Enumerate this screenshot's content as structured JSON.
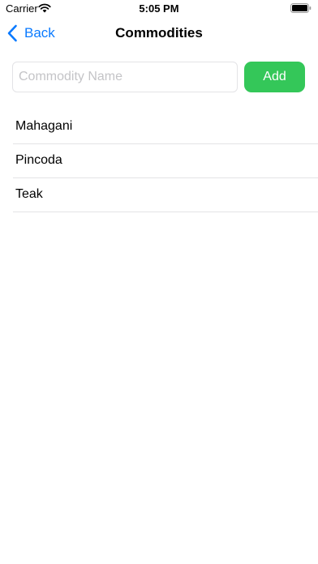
{
  "status_bar": {
    "carrier": "Carrier",
    "time": "5:05 PM",
    "wifi_icon": "wifi-icon",
    "battery_icon": "battery-icon"
  },
  "nav": {
    "back_label": "Back",
    "back_icon": "chevron-left-icon",
    "title": "Commodities"
  },
  "form": {
    "input_value": "",
    "input_placeholder": "Commodity Name",
    "add_label": "Add"
  },
  "commodities": [
    {
      "label": "Mahagani"
    },
    {
      "label": "Pincoda"
    },
    {
      "label": "Teak"
    }
  ],
  "colors": {
    "accent": "#0a7aff",
    "add_button": "#34c759",
    "separator": "#e3e3e6",
    "placeholder": "#c4c4c7"
  }
}
